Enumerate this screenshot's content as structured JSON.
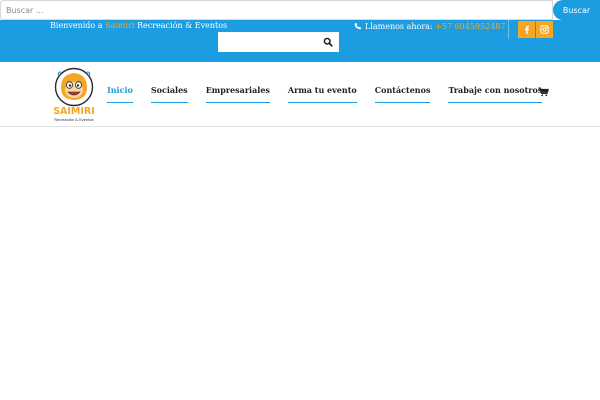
{
  "search": {
    "placeholder": "Buscar ...",
    "button_label": "Buscar"
  },
  "topbar": {
    "welcome_prefix": "Bienvenido a ",
    "welcome_brand": "Saimiri",
    "welcome_suffix": " Recreación & Eventos",
    "phone_label": "Llamenos ahora: ",
    "phone_number": "+57 6045952487",
    "social": [
      "facebook-icon",
      "instagram-icon"
    ]
  },
  "logo": {
    "name": "SAIMIRI",
    "tagline": "Recreación & Eventos"
  },
  "nav": {
    "items": [
      {
        "label": "Inicio",
        "active": true
      },
      {
        "label": "Sociales",
        "active": false
      },
      {
        "label": "Empresariales",
        "active": false
      },
      {
        "label": "Arma tu evento",
        "active": false
      },
      {
        "label": "Contáctenos",
        "active": false
      },
      {
        "label": "Trabaje con nosotros",
        "active": false
      }
    ],
    "cart_icon": "cart-icon"
  },
  "colors": {
    "primary_blue": "#1d9de1",
    "accent_orange": "#f5a623"
  }
}
